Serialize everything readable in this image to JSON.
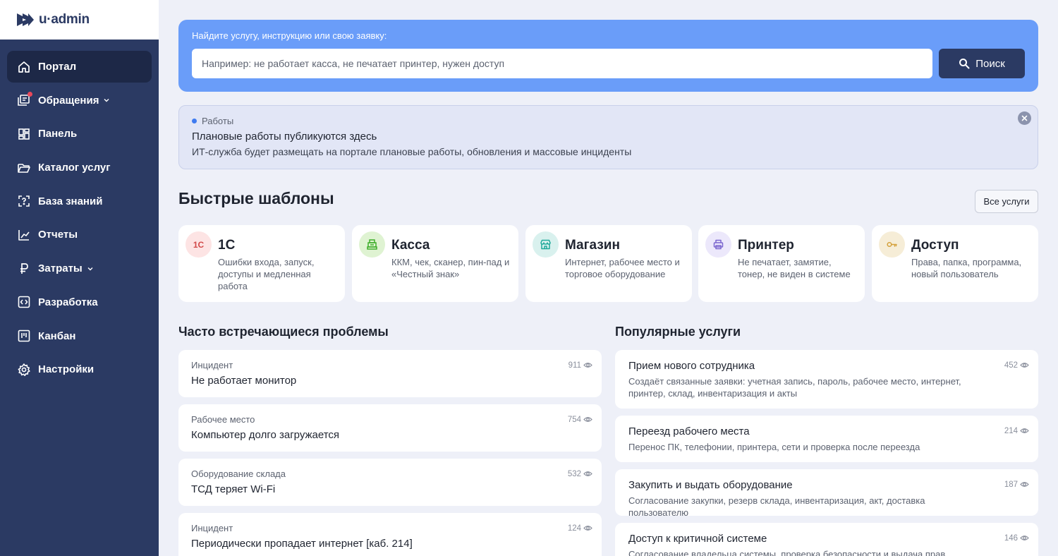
{
  "app": {
    "logo_text": "u·admin"
  },
  "sidebar": {
    "items": [
      {
        "label": "Портал",
        "icon": "home-icon",
        "active": true
      },
      {
        "label": "Обращения",
        "icon": "tickets-icon",
        "has_dot": true,
        "has_chevron": true
      },
      {
        "label": "Панель",
        "icon": "dashboard-icon"
      },
      {
        "label": "Каталог услуг",
        "icon": "folder-icon"
      },
      {
        "label": "База знаний",
        "icon": "knowledge-icon"
      },
      {
        "label": "Отчеты",
        "icon": "chart-icon"
      },
      {
        "label": "Затраты",
        "icon": "ruble-icon",
        "has_chevron": true
      },
      {
        "label": "Разработка",
        "icon": "code-icon"
      },
      {
        "label": "Канбан",
        "icon": "kanban-icon"
      },
      {
        "label": "Настройки",
        "icon": "gear-icon"
      }
    ]
  },
  "search": {
    "label": "Найдите услугу, инструкцию или свою заявку:",
    "placeholder": "Например: не работает касса, не печатает принтер, нужен доступ",
    "button_label": "Поиск",
    "panel_color": "#6a9df9"
  },
  "notice": {
    "tag": "Работы",
    "title": "Плановые работы публикуются здесь",
    "text": "ИТ-служба будет размещать на портале плановые работы, обновления и массовые инциденты"
  },
  "templates": {
    "title": "Быстрые шаблоны",
    "all_button": "Все услуги",
    "items": [
      {
        "name": "1С",
        "icon_text": "1С",
        "desc": "Ошибки входа, запуск, доступы и медленная работа",
        "icon_bg": "#fde4e4",
        "icon_color": "#d24a4a"
      },
      {
        "name": "Касса",
        "icon": "cash-register-icon",
        "desc": "ККМ, чек, сканер, пин-пад и «Честный знак»",
        "icon_bg": "#dff3d2",
        "icon_color": "#3fae2b"
      },
      {
        "name": "Магазин",
        "icon": "store-icon",
        "desc": "Интернет, рабочее место и торговое оборудование",
        "icon_bg": "#d9f1ee",
        "icon_color": "#1fa99a"
      },
      {
        "name": "Принтер",
        "icon": "printer-icon",
        "desc": "Не печатает, замятие, тонер, не виден в системе",
        "icon_bg": "#ece8fb",
        "icon_color": "#7b66cf"
      },
      {
        "name": "Доступ",
        "icon": "key-icon",
        "desc": "Права, папка, программа, новый пользователь",
        "icon_bg": "#f6edd7",
        "icon_color": "#d4a13c"
      }
    ]
  },
  "problems": {
    "title": "Часто встречающиеся проблемы",
    "items": [
      {
        "category": "Инцидент",
        "title": "Не работает монитор",
        "views": "911"
      },
      {
        "category": "Рабочее место",
        "title": "Компьютер долго загружается",
        "views": "754"
      },
      {
        "category": "Оборудование склада",
        "title": "ТСД теряет Wi-Fi",
        "views": "532"
      },
      {
        "category": "Инцидент",
        "title": "Периодически пропадает интернет [каб. 214]",
        "views": "124"
      }
    ]
  },
  "services": {
    "title": "Популярные услуги",
    "items": [
      {
        "title": "Прием нового сотрудника",
        "desc": "Создаёт связанные заявки: учетная запись, пароль, рабочее место, интернет, принтер, склад, инвентаризация и акты",
        "views": "452"
      },
      {
        "title": "Переезд рабочего места",
        "desc": "Перенос ПК, телефонии, принтера, сети и проверка после переезда",
        "views": "214"
      },
      {
        "title": "Закупить и выдать оборудование",
        "desc": "Согласование закупки, резерв склада, инвентаризация, акт, доставка пользователю",
        "views": "187"
      },
      {
        "title": "Доступ к критичной системе",
        "desc": "Согласование владельца системы, проверка безопасности и выдача прав",
        "views": "146"
      }
    ]
  }
}
